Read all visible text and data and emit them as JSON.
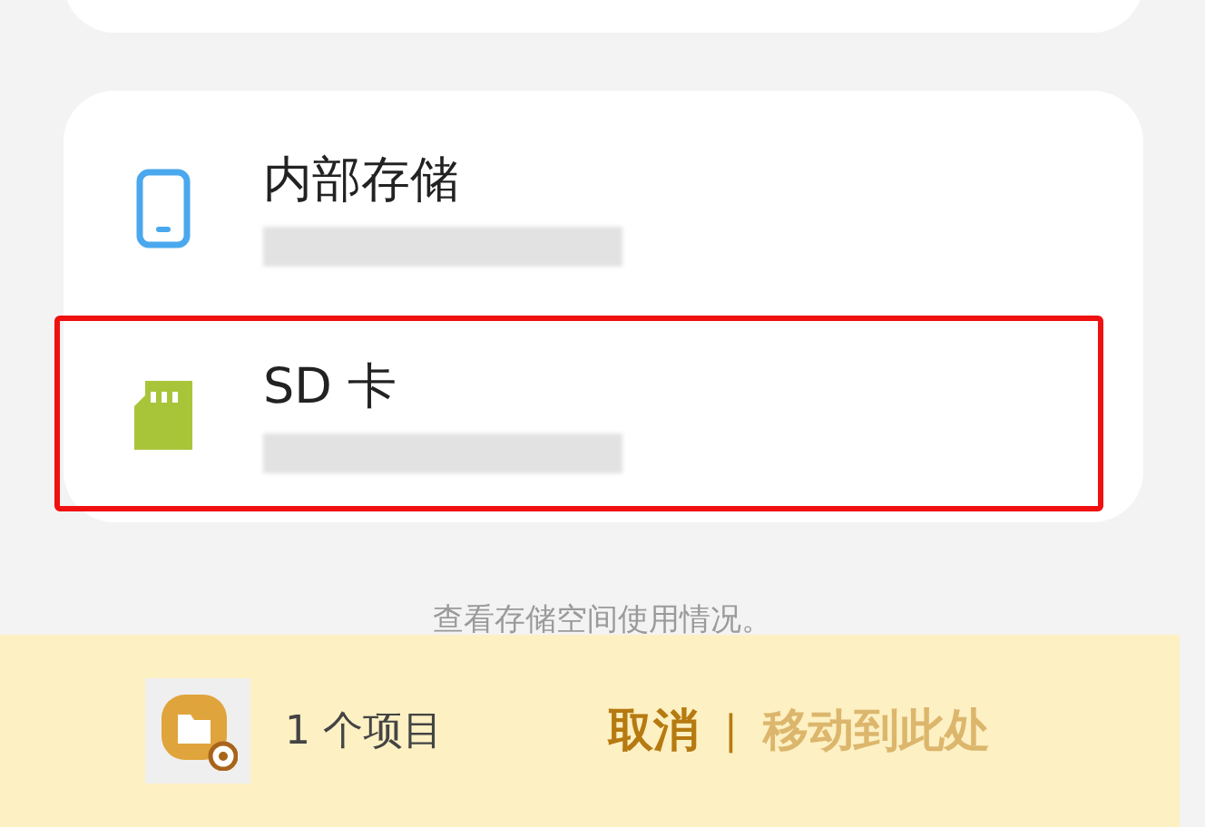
{
  "storage_items": [
    {
      "kind": "phone",
      "title": "内部存储",
      "highlighted": false
    },
    {
      "kind": "sdcard",
      "title": "SD 卡",
      "highlighted": true
    }
  ],
  "caption": "查看存储空间使用情况。",
  "action_bar": {
    "count": "1 个项目",
    "cancel": "取消",
    "separator": "|",
    "move": "移动到此处"
  }
}
